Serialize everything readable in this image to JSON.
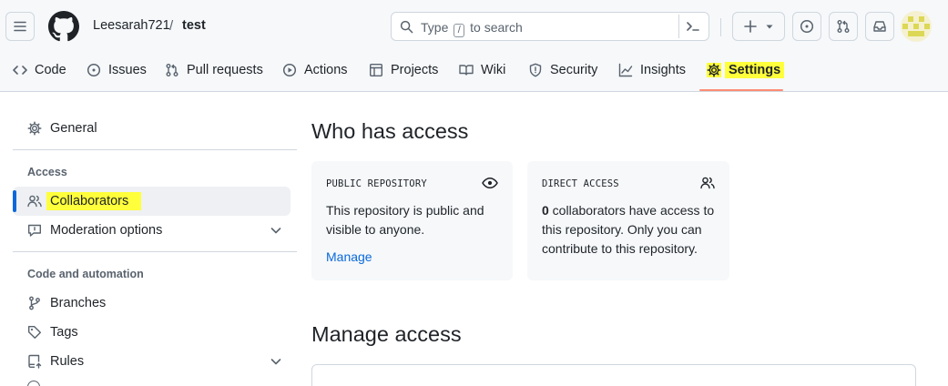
{
  "header": {
    "owner": "Leesarah721",
    "separator": "/",
    "repo": "test",
    "search": {
      "placeholder_before": "Type",
      "key": "/",
      "placeholder_after": "to search"
    },
    "avatar_color": "#dcd855"
  },
  "nav": {
    "tabs": [
      {
        "label": "Code",
        "icon": "code-icon"
      },
      {
        "label": "Issues",
        "icon": "issue-opened-icon"
      },
      {
        "label": "Pull requests",
        "icon": "git-pull-request-icon"
      },
      {
        "label": "Actions",
        "icon": "play-icon"
      },
      {
        "label": "Projects",
        "icon": "table-icon"
      },
      {
        "label": "Wiki",
        "icon": "book-icon"
      },
      {
        "label": "Security",
        "icon": "shield-icon"
      },
      {
        "label": "Insights",
        "icon": "graph-icon"
      },
      {
        "label": "Settings",
        "icon": "gear-icon",
        "active": true
      }
    ],
    "highlight_color": "#ffff3b",
    "underline_color": "#fd8c73"
  },
  "sidebar": {
    "general": "General",
    "access_heading": "Access",
    "collaborators": "Collaborators",
    "moderation": "Moderation options",
    "code_heading": "Code and automation",
    "branches": "Branches",
    "tags": "Tags",
    "rules": "Rules"
  },
  "main": {
    "who_title": "Who has access",
    "public_card": {
      "title": "PUBLIC REPOSITORY",
      "line1": "This repository is public and",
      "line2": "visible to anyone.",
      "link": "Manage"
    },
    "direct_card": {
      "title": "DIRECT ACCESS",
      "count": "0",
      "line1": " collaborators have access to",
      "line2": "this repository. Only you can",
      "line3": "contribute to this repository."
    },
    "manage_title": "Manage access"
  }
}
